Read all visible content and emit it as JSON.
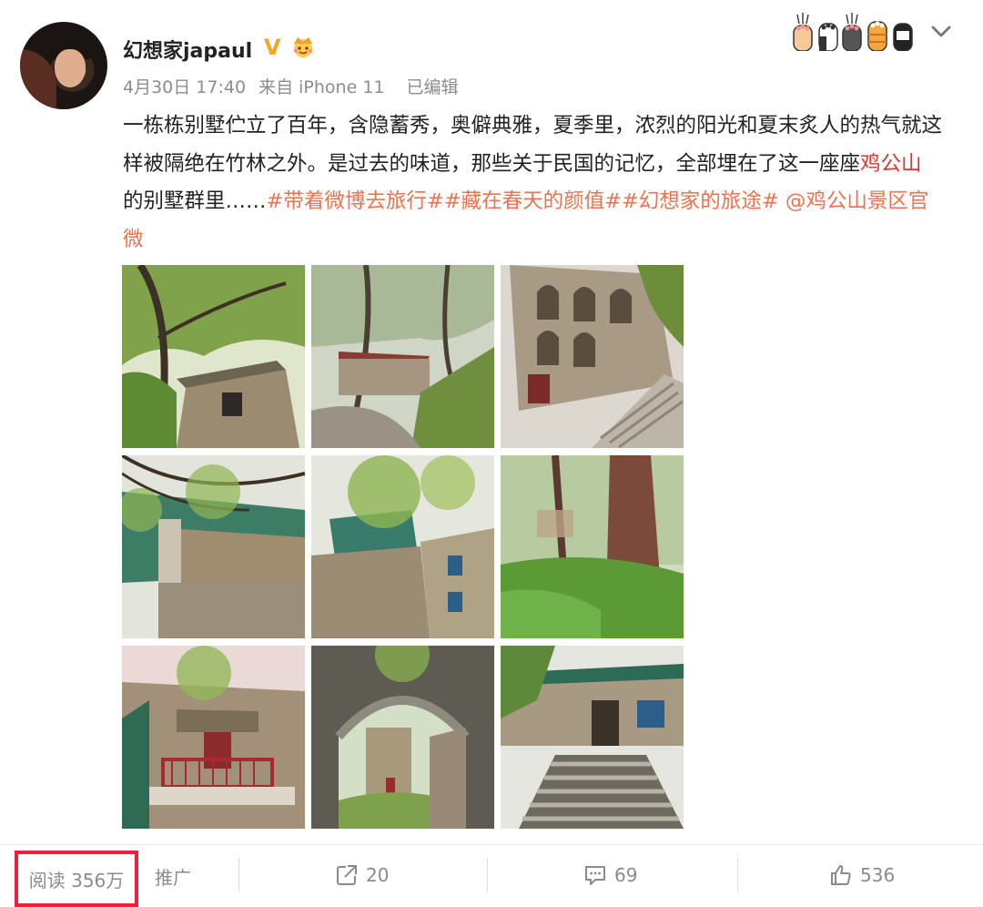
{
  "header": {
    "username": "幻想家japaul",
    "verified_mark": "V",
    "date": "4月30日 17:40",
    "source": "来自 iPhone 11",
    "edited": "已编辑"
  },
  "post": {
    "segments": [
      {
        "type": "text",
        "value": "一栋栋别墅伫立了百年，含隐蓄秀，奥僻典雅，夏季里，浓烈的阳光和夏末炙人的热气就这样被隔绝在竹林之外。是过去的味道，那些关于民国的记忆，全部埋在了这一座座"
      },
      {
        "type": "mention",
        "value": "鸡公山"
      },
      {
        "type": "text",
        "value": "的别墅群里……"
      },
      {
        "type": "link",
        "value": "#带着微博去旅行#"
      },
      {
        "type": "link",
        "value": "#藏在春天的颜值#"
      },
      {
        "type": "link",
        "value": "#幻想家的旅途#"
      },
      {
        "type": "text",
        "value": " "
      },
      {
        "type": "link",
        "value": "@鸡公山景区官微"
      }
    ],
    "images": [
      "photo-villa-under-tree",
      "photo-red-roof-house-path",
      "photo-arched-villa-stairs",
      "photo-balcony-corner-low-angle",
      "photo-green-trim-villa",
      "photo-forest-tree-trunk",
      "photo-red-balcony-villa",
      "photo-stone-archway",
      "photo-villa-front-stairs"
    ]
  },
  "actions": {
    "reads": "阅读 356万",
    "promote": "推广",
    "reposts": "20",
    "comments": "69",
    "likes": "536"
  },
  "colors": {
    "link": "#eb7350",
    "mention": "#e8322d",
    "highlight_box": "#ee1f3a",
    "verified": "#f5a623"
  }
}
